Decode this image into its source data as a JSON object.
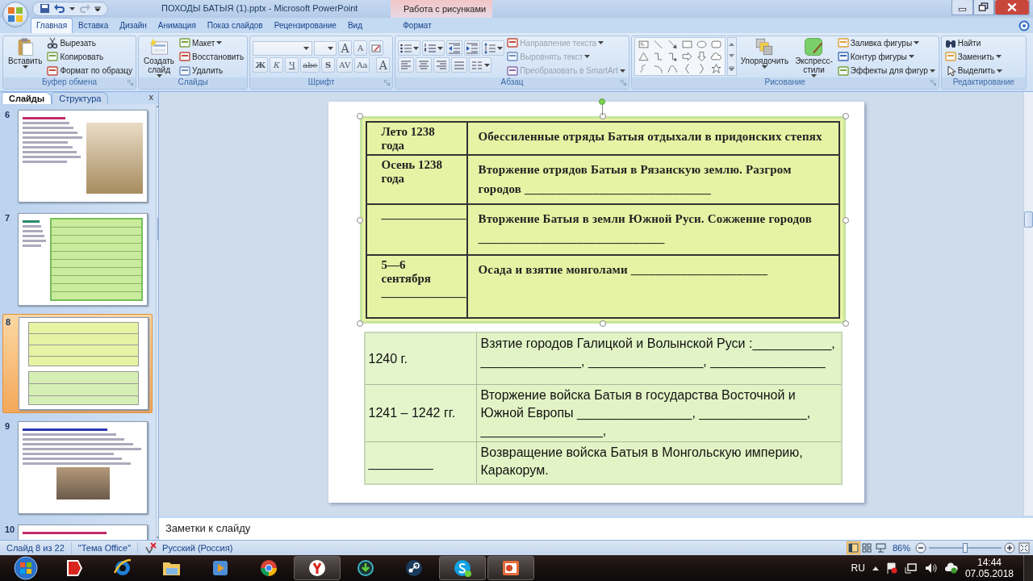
{
  "window": {
    "title": "ПОХОДЫ БАТЫЯ (1).pptx - Microsoft PowerPoint",
    "context_label": "Работа с рисунками"
  },
  "ribbon_tabs": [
    {
      "label": "Главная",
      "selected": true,
      "kind": "normal"
    },
    {
      "label": "Вставка",
      "selected": false,
      "kind": "normal"
    },
    {
      "label": "Дизайн",
      "selected": false,
      "kind": "normal"
    },
    {
      "label": "Анимация",
      "selected": false,
      "kind": "normal"
    },
    {
      "label": "Показ слайдов",
      "selected": false,
      "kind": "normal"
    },
    {
      "label": "Рецензирование",
      "selected": false,
      "kind": "normal"
    },
    {
      "label": "Вид",
      "selected": false,
      "kind": "normal"
    },
    {
      "label": "Формат",
      "selected": false,
      "kind": "contextual"
    }
  ],
  "ribbon_groups": [
    {
      "title": "Буфер обмена",
      "kind": "buttons",
      "items": [
        {
          "kind": "large",
          "label": "Вставить",
          "menu": true,
          "disabled": false
        },
        {
          "kind": "small",
          "label": "Вырезать",
          "menu": false,
          "disabled": false
        },
        {
          "kind": "small",
          "label": "Копировать",
          "menu": false,
          "disabled": false
        },
        {
          "kind": "small",
          "label": "Формат по образцу",
          "menu": false,
          "disabled": false
        }
      ]
    },
    {
      "title": "Слайды",
      "kind": "buttons",
      "items": [
        {
          "kind": "large",
          "label": "Создать слайд",
          "menu": true,
          "disabled": false
        },
        {
          "kind": "small",
          "label": "Макет",
          "menu": true,
          "disabled": false
        },
        {
          "kind": "small",
          "label": "Восстановить",
          "menu": false,
          "disabled": false
        },
        {
          "kind": "small",
          "label": "Удалить",
          "menu": false,
          "disabled": false
        }
      ]
    },
    {
      "title": "Шрифт",
      "kind": "font",
      "size_buttons": [
        "A",
        "A"
      ],
      "format_buttons": [
        "Ж",
        "К",
        "Ч",
        "abc",
        "S",
        "AV",
        "Aa",
        "A"
      ]
    },
    {
      "title": "Абзац",
      "kind": "paragraph",
      "items": [
        {
          "kind": "small",
          "label": "Направление текста",
          "menu": true,
          "disabled": true
        },
        {
          "kind": "small",
          "label": "Выровнять текст",
          "menu": true,
          "disabled": true
        },
        {
          "kind": "small",
          "label": "Преобразовать в SmartArt",
          "menu": true,
          "disabled": true
        }
      ]
    },
    {
      "title": "Рисование",
      "kind": "drawing",
      "items": [
        {
          "kind": "large",
          "label": "Упорядочить",
          "menu": true,
          "disabled": false
        },
        {
          "kind": "large",
          "label": "Экспресс-стили",
          "menu": true,
          "disabled": false
        },
        {
          "kind": "small",
          "label": "Заливка фигуры",
          "menu": true,
          "disabled": false
        },
        {
          "kind": "small",
          "label": "Контур фигуры",
          "menu": true,
          "disabled": false
        },
        {
          "kind": "small",
          "label": "Эффекты для фигур",
          "menu": true,
          "disabled": false
        }
      ]
    },
    {
      "title": "Редактирование",
      "kind": "buttons",
      "items": [
        {
          "kind": "small",
          "label": "Найти",
          "menu": false,
          "disabled": false
        },
        {
          "kind": "small",
          "label": "Заменить",
          "menu": true,
          "disabled": false
        },
        {
          "kind": "small",
          "label": "Выделить",
          "menu": true,
          "disabled": false
        }
      ]
    }
  ],
  "slide_panel": {
    "tabs": [
      {
        "label": "Слайды",
        "selected": true
      },
      {
        "label": "Структура",
        "selected": false
      }
    ],
    "close": "x",
    "thumbnails": [
      {
        "number": "6",
        "kind": "text-image",
        "selected": false
      },
      {
        "number": "7",
        "kind": "text-table",
        "selected": false
      },
      {
        "number": "8",
        "kind": "two-tables",
        "selected": true
      },
      {
        "number": "9",
        "kind": "questions-image",
        "selected": false
      },
      {
        "number": "10",
        "kind": "title",
        "selected": false
      }
    ]
  },
  "slide": {
    "picture_selected": true,
    "picture_table": [
      {
        "date": "Лето 1238 года",
        "event": "Обессиленные отряды Батыя отдыхали в придонских степях"
      },
      {
        "date": "Осень 1238 года",
        "event": "Вторжение отрядов Батыя в Рязанскую землю. Разгром городов ______________________________"
      },
      {
        "date": "______________",
        "event": "Вторжение Батыя в земли Южной Руси. Сожжение городов ______________________________"
      },
      {
        "date": "5—6 сентября ______________",
        "event": "Осада и взятие монголами ______________________"
      }
    ],
    "table": [
      {
        "date": "1240 г.",
        "event": "Взятие городов Галицкой и Волынской Руси :___________, ______________, ________________, ________________"
      },
      {
        "date": "1241 – 1242 гг.",
        "event": "Вторжение войска Батыя в государства Восточной и Южной Европы ________________, _______________, _________________,"
      },
      {
        "date": "_________",
        "event": "Возвращение войска Батыя в Монгольскую империю, Каракорум."
      }
    ]
  },
  "notes": {
    "placeholder": "Заметки к слайду"
  },
  "status_bar": {
    "slide": "Слайд 8 из 22",
    "theme": "\"Тема Office\"",
    "language": "Русский (Россия)",
    "views": [
      {
        "selected": true
      },
      {
        "selected": false
      },
      {
        "selected": false
      }
    ],
    "zoom": "86%",
    "zoom_slider": {
      "level": 0.5
    }
  },
  "taskbar": {
    "apps": [
      {
        "kind": "yandex",
        "open": false
      },
      {
        "kind": "ie",
        "open": false
      },
      {
        "kind": "folder",
        "open": false
      },
      {
        "kind": "player",
        "open": false
      },
      {
        "kind": "chrome",
        "open": false
      },
      {
        "kind": "yabrowser",
        "open": true
      },
      {
        "kind": "torrent",
        "open": false
      },
      {
        "kind": "steam",
        "open": false
      },
      {
        "kind": "skype",
        "open": true
      },
      {
        "kind": "powerpoint",
        "open": true
      }
    ],
    "language": "RU",
    "time": "14:44",
    "date": "07.05.2018"
  }
}
